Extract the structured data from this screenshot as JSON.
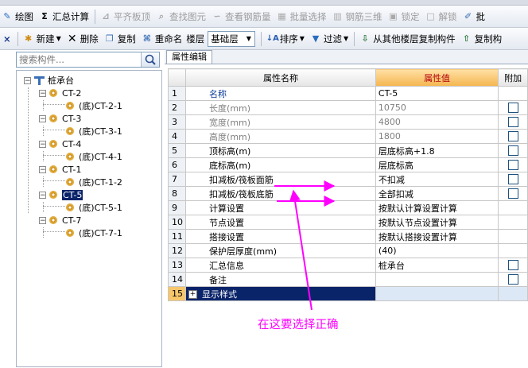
{
  "toolbar1": {
    "items": [
      {
        "icon": "draw-icon",
        "label": "绘图",
        "enabled": true
      },
      {
        "icon": "sigma-icon",
        "label": "汇总计算",
        "enabled": true
      },
      {
        "icon": "align-slab-top-icon",
        "label": "平齐板顶",
        "enabled": false
      },
      {
        "icon": "find-element-icon",
        "label": "查找图元",
        "enabled": false
      },
      {
        "icon": "view-rebar-icon",
        "label": "查看钢筋量",
        "enabled": false
      },
      {
        "icon": "batch-select-icon",
        "label": "批量选择",
        "enabled": false
      },
      {
        "icon": "rebar-3d-icon",
        "label": "钢筋三维",
        "enabled": false
      },
      {
        "icon": "lock-icon",
        "label": "锁定",
        "enabled": false
      },
      {
        "icon": "unlock-icon",
        "label": "解锁",
        "enabled": false
      },
      {
        "icon": "batch-icon",
        "label": "批",
        "enabled": true
      }
    ]
  },
  "toolbar2": {
    "close_symbol": "×",
    "new_label": "新建",
    "delete_label": "删除",
    "copy_label": "复制",
    "rename_label": "重命名",
    "floor_label": "楼层",
    "floor_value": "基础层",
    "sort_label": "排序",
    "filter_label": "过滤",
    "copy_from_floor_label": "从其他楼层复制构件",
    "copy_to_label": "复制构"
  },
  "left_panel": {
    "search_placeholder": "搜索构件...",
    "tree": {
      "root": "桩承台",
      "groups": [
        {
          "name": "CT-2",
          "child": "(底)CT-2-1"
        },
        {
          "name": "CT-3",
          "child": "(底)CT-3-1"
        },
        {
          "name": "CT-4",
          "child": "(底)CT-4-1"
        },
        {
          "name": "CT-1",
          "child": "(底)CT-1-2"
        },
        {
          "name": "CT-5",
          "child": "(底)CT-5-1",
          "selected": true
        },
        {
          "name": "CT-7",
          "child": "(底)CT-7-1"
        }
      ]
    }
  },
  "properties": {
    "tab_label": "属性编辑",
    "headers": {
      "name": "属性名称",
      "value": "属性值",
      "extra": "附加"
    },
    "rows": [
      {
        "no": "1",
        "name": "名称",
        "value": "CT-5",
        "checkbox": false,
        "style": "blue"
      },
      {
        "no": "2",
        "name": "长度(mm)",
        "value": "10750",
        "checkbox": true,
        "style": "gray"
      },
      {
        "no": "3",
        "name": "宽度(mm)",
        "value": "4800",
        "checkbox": true,
        "style": "gray"
      },
      {
        "no": "4",
        "name": "高度(mm)",
        "value": "1800",
        "checkbox": true,
        "style": "gray"
      },
      {
        "no": "5",
        "name": "顶标高(m)",
        "value": "层底标高+1.8",
        "checkbox": true,
        "style": "normal"
      },
      {
        "no": "6",
        "name": "底标高(m)",
        "value": "层底标高",
        "checkbox": true,
        "style": "normal"
      },
      {
        "no": "7",
        "name": "扣减板/筏板面筋",
        "value": "不扣减",
        "checkbox": true,
        "style": "normal"
      },
      {
        "no": "8",
        "name": "扣减板/筏板底筋",
        "value": "全部扣减",
        "checkbox": true,
        "style": "normal"
      },
      {
        "no": "9",
        "name": "计算设置",
        "value": "按默认计算设置计算",
        "checkbox": false,
        "style": "normal"
      },
      {
        "no": "10",
        "name": "节点设置",
        "value": "按默认节点设置计算",
        "checkbox": false,
        "style": "normal"
      },
      {
        "no": "11",
        "name": "搭接设置",
        "value": "按默认搭接设置计算",
        "checkbox": false,
        "style": "normal"
      },
      {
        "no": "12",
        "name": "保护层厚度(mm)",
        "value": "(40)",
        "checkbox": false,
        "style": "normal"
      },
      {
        "no": "13",
        "name": "汇总信息",
        "value": "桩承台",
        "checkbox": true,
        "style": "normal"
      },
      {
        "no": "14",
        "name": "备注",
        "value": "",
        "checkbox": true,
        "style": "normal"
      },
      {
        "no": "15",
        "name": "显示样式",
        "value": "",
        "checkbox": false,
        "style": "selected",
        "expander": "+"
      }
    ]
  },
  "annotation": {
    "text": "在这要选择正确",
    "color": "#ff00ff"
  }
}
